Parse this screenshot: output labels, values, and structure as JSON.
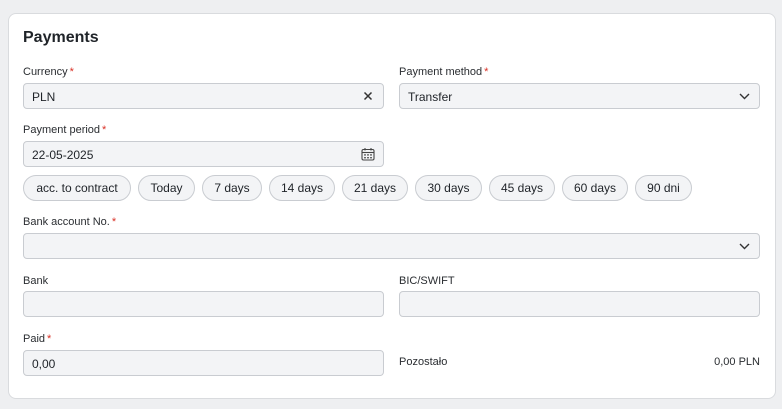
{
  "section": {
    "title": "Payments"
  },
  "currency": {
    "label": "Currency",
    "required_mark": "*",
    "value": "PLN",
    "clear_icon": "close-icon"
  },
  "payment_method": {
    "label": "Payment method",
    "required_mark": "*",
    "value": "Transfer",
    "dropdown_icon": "chevron-down-icon"
  },
  "payment_period": {
    "label": "Payment period",
    "required_mark": "*",
    "value": "22-05-2025",
    "calendar_icon": "calendar-icon"
  },
  "period_chips": [
    "acc. to contract",
    "Today",
    "7 days",
    "14 days",
    "21 days",
    "30 days",
    "45 days",
    "60 days",
    "90 dni"
  ],
  "bank_account": {
    "label": "Bank account No.",
    "required_mark": "*",
    "value": "",
    "dropdown_icon": "chevron-down-icon"
  },
  "bank": {
    "label": "Bank",
    "value": ""
  },
  "bic_swift": {
    "label": "BIC/SWIFT",
    "value": ""
  },
  "paid": {
    "label": "Paid",
    "required_mark": "*",
    "value": "0,00"
  },
  "remaining": {
    "label": "Pozostało",
    "value": "0,00 PLN"
  },
  "colors": {
    "required": "#d93025",
    "field_bg": "#f3f4f6",
    "field_border": "#c9ccd1"
  }
}
